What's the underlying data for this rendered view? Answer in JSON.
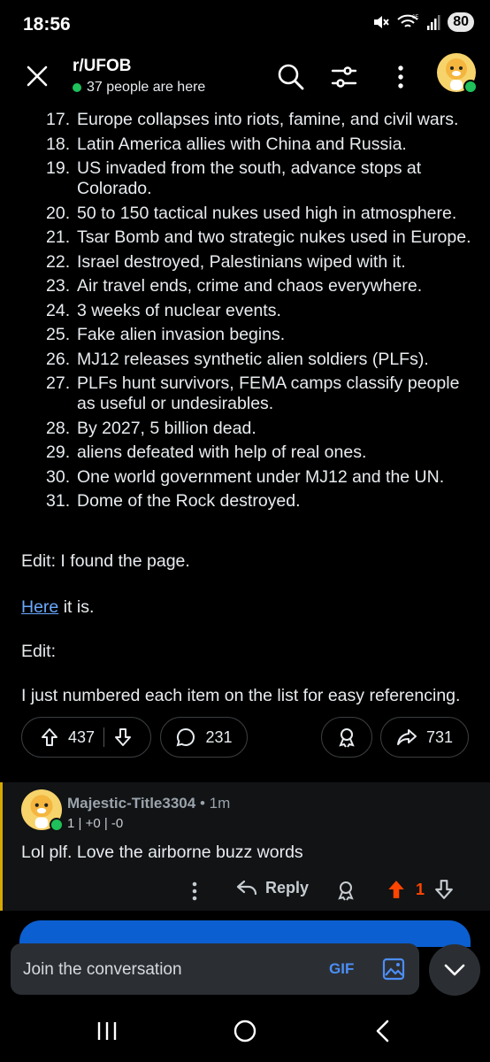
{
  "status": {
    "time": "18:56",
    "battery": "80",
    "network": "6E"
  },
  "header": {
    "subreddit": "r/UFOB",
    "online_text": "37 people are here"
  },
  "post": {
    "items": [
      {
        "n": "17.",
        "text": "Europe collapses into riots, famine, and civil wars."
      },
      {
        "n": "18.",
        "text": "Latin America allies with China and Russia."
      },
      {
        "n": "19.",
        "text": "US invaded from the south, advance stops at Colorado."
      },
      {
        "n": "20.",
        "text": "50 to 150 tactical nukes used high in atmosphere."
      },
      {
        "n": "21.",
        "text": "Tsar Bomb and two strategic nukes used in Europe."
      },
      {
        "n": "22.",
        "text": "Israel destroyed, Palestinians wiped with it."
      },
      {
        "n": "23.",
        "text": "Air travel ends, crime and chaos everywhere."
      },
      {
        "n": "24.",
        "text": "3 weeks of nuclear events."
      },
      {
        "n": "25.",
        "text": "Fake alien invasion begins."
      },
      {
        "n": "26.",
        "text": "MJ12 releases synthetic alien soldiers (PLFs)."
      },
      {
        "n": "27.",
        "text": "PLFs hunt survivors, FEMA camps classify people as useful or undesirables."
      },
      {
        "n": "28.",
        "text": "By 2027, 5 billion dead."
      },
      {
        "n": "29.",
        "text": "aliens defeated with help of real ones."
      },
      {
        "n": "30.",
        "text": "One world government under MJ12 and the UN."
      },
      {
        "n": "31.",
        "text": "Dome of the Rock destroyed."
      }
    ],
    "edit1": "Edit: I found the page.",
    "here_link": "Here",
    "here_rest": " it is.",
    "edit2": "Edit:",
    "note": "I just numbered each item on the list for easy referencing.",
    "upvotes": "437",
    "comments": "231",
    "shares": "731"
  },
  "comment": {
    "author": "Majestic-Title3304",
    "age": " • 1m",
    "score_line": "1 | +0 | -0",
    "text": "Lol plf. Love the airborne buzz words",
    "reply_label": "Reply",
    "votes": "1"
  },
  "composer": {
    "placeholder": "Join the conversation",
    "gif_label": "GIF"
  },
  "colors": {
    "online": "#1ec15a",
    "link": "#6aa9ff",
    "upvote_active": "#ff4500",
    "accent_bar": "#d7a900",
    "gif": "#4c8ef7"
  }
}
